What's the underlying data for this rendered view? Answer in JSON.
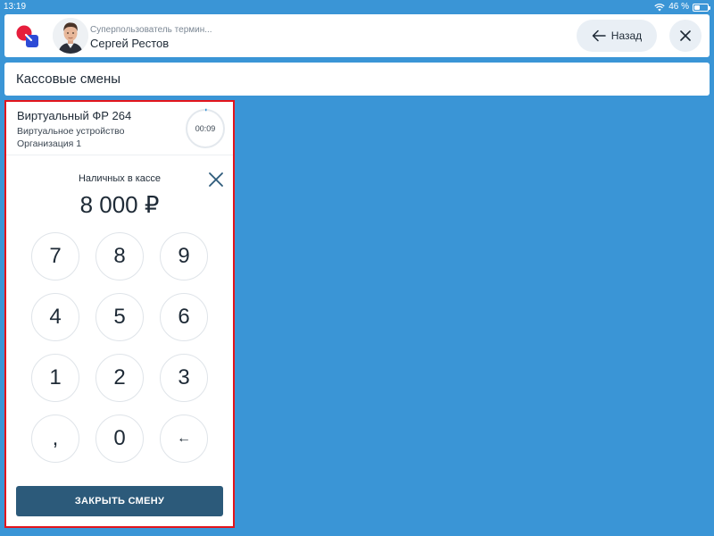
{
  "status_bar": {
    "time": "13:19",
    "battery": "46 %",
    "battery_level": 0.46
  },
  "header": {
    "user_role": "Суперпользователь термин...",
    "user_name": "Сергей Рестов",
    "back_label": "Назад",
    "icons": [
      "app-logo-icon",
      "avatar",
      "arrow-left-icon",
      "close-icon"
    ]
  },
  "section": {
    "title": "Кассовые смены"
  },
  "register": {
    "name": "Виртуальный ФР 264",
    "device": "Виртуальное устройство",
    "organization": "Организация 1",
    "timer": "00:09"
  },
  "cash": {
    "label": "Наличных в кассе",
    "amount": "8 000 ₽"
  },
  "keypad": {
    "keys": [
      "7",
      "8",
      "9",
      "4",
      "5",
      "6",
      "1",
      "2",
      "3",
      ",",
      "0",
      "←"
    ]
  },
  "actions": {
    "close_shift": "ЗАКРЫТЬ СМЕНУ"
  },
  "colors": {
    "background": "#3a95d6",
    "panel_border": "#e2141c",
    "button_primary": "#2c5a7a"
  }
}
